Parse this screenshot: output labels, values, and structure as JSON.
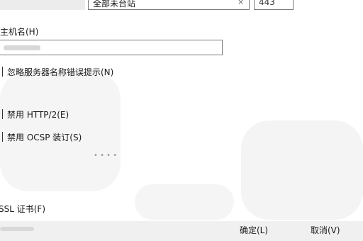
{
  "top_row": {
    "mode_select_value": "全部未台站",
    "port_value": "443"
  },
  "hostname": {
    "label": "主机名(H)",
    "value": ""
  },
  "options": {
    "ignore_hostname_mismatch": "忽略服务器名称错误提示(N)",
    "disable_http2": "禁用 HTTP/2(E)",
    "disable_ocsp_stapling": "禁用 OCSP 装订(S)"
  },
  "faint_text": "• • • •",
  "ssl_cert_label": "SSL 证书(F)",
  "footer": {
    "confirm_label": "确定(L)",
    "cancel_label": "取消(V)"
  }
}
